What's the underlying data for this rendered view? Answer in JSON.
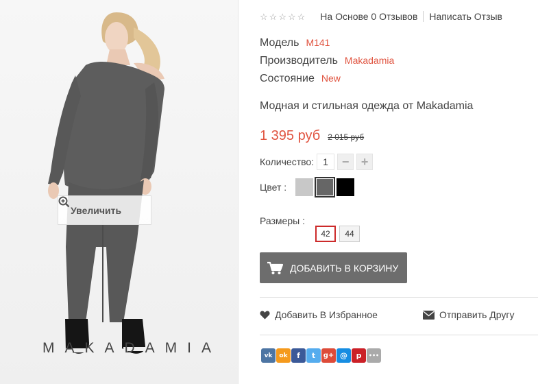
{
  "product_image": {
    "zoom_label": "Увеличить",
    "brand_watermark": "MAKADAMIA"
  },
  "reviews": {
    "rating_stars": 0,
    "based_on": "На Основе 0 Отзывов",
    "write_review": "Написать Отзыв"
  },
  "specs": [
    {
      "label": "Модель",
      "value": "M141"
    },
    {
      "label": "Производитель",
      "value": "Makadamia"
    },
    {
      "label": "Состояние",
      "value": "New"
    }
  ],
  "description": "Модная и стильная одежда от Makadamia",
  "price": {
    "current": "1 395 руб",
    "old": "2 015 руб"
  },
  "quantity": {
    "label": "Количество:",
    "value": "1",
    "minus": "−",
    "plus": "+"
  },
  "color": {
    "label": "Цвет :",
    "swatches": [
      {
        "name": "light-gray",
        "hex": "#c8c8c8",
        "selected": false
      },
      {
        "name": "dark-gray",
        "hex": "#666666",
        "selected": true
      },
      {
        "name": "black",
        "hex": "#000000",
        "selected": false
      }
    ]
  },
  "sizes": {
    "label": "Размеры :",
    "options": [
      {
        "label": "42",
        "selected": true
      },
      {
        "label": "44",
        "selected": false
      }
    ]
  },
  "cart": {
    "label": "ДОБАВИТЬ В КОРЗИНУ"
  },
  "actions": {
    "favorite": "Добавить В Избранное",
    "send_friend": "Отправить Другу"
  },
  "share": [
    {
      "name": "vk",
      "glyph": "vk",
      "color": "#4d75a3"
    },
    {
      "name": "odnoklassniki",
      "glyph": "ok",
      "color": "#f59a1c"
    },
    {
      "name": "facebook",
      "glyph": "f",
      "color": "#3b5998"
    },
    {
      "name": "twitter",
      "glyph": "t",
      "color": "#55acee"
    },
    {
      "name": "google-plus",
      "glyph": "g+",
      "color": "#dd4b39"
    },
    {
      "name": "mail",
      "glyph": "@",
      "color": "#168de2"
    },
    {
      "name": "pinterest",
      "glyph": "p",
      "color": "#cb2027"
    },
    {
      "name": "more",
      "glyph": "•••",
      "color": "#aaaaaa"
    }
  ]
}
